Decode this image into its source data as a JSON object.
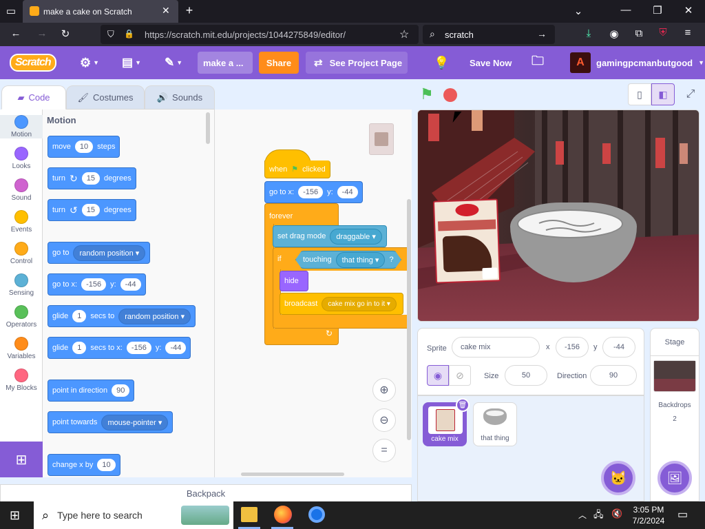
{
  "browser": {
    "tab_title": "make a cake on Scratch",
    "url": "https://scratch.mit.edu/projects/1044275849/editor/",
    "search": "scratch"
  },
  "menubar": {
    "logo": "Scratch",
    "project_title": "make a ...",
    "share": "Share",
    "see_project_page": "See Project Page",
    "save_now": "Save Now",
    "username": "gamingpcmanbutgood"
  },
  "tabs": {
    "code": "Code",
    "costumes": "Costumes",
    "sounds": "Sounds"
  },
  "categories": [
    {
      "label": "Motion",
      "color": "#4c97ff"
    },
    {
      "label": "Looks",
      "color": "#9966ff"
    },
    {
      "label": "Sound",
      "color": "#cf63cf"
    },
    {
      "label": "Events",
      "color": "#ffbf00"
    },
    {
      "label": "Control",
      "color": "#ffab19"
    },
    {
      "label": "Sensing",
      "color": "#5cb1d6"
    },
    {
      "label": "Operators",
      "color": "#59c059"
    },
    {
      "label": "Variables",
      "color": "#ff8c1a"
    },
    {
      "label": "My Blocks",
      "color": "#ff6680"
    }
  ],
  "palette": {
    "heading": "Motion",
    "move": {
      "a": "move",
      "v": "10",
      "b": "steps"
    },
    "turn_right": {
      "a": "turn",
      "v": "15",
      "b": "degrees"
    },
    "turn_left": {
      "a": "turn",
      "v": "15",
      "b": "degrees"
    },
    "goto": {
      "a": "go to",
      "d": "random position"
    },
    "gotoxy": {
      "a": "go to x:",
      "x": "-156",
      "y_label": "y:",
      "y": "-44"
    },
    "glide": {
      "a": "glide",
      "v": "1",
      "b": "secs to",
      "d": "random position"
    },
    "glidexy": {
      "a": "glide",
      "v": "1",
      "b": "secs to x:",
      "x": "-156",
      "y_label": "y:",
      "y": "-44"
    },
    "point_dir": {
      "a": "point in direction",
      "v": "90"
    },
    "point_towards": {
      "a": "point towards",
      "d": "mouse-pointer"
    },
    "change_x": {
      "a": "change x by",
      "v": "10"
    }
  },
  "script": {
    "when_flag": {
      "a": "when",
      "b": "clicked"
    },
    "goto": {
      "a": "go to x:",
      "x": "-156",
      "y_label": "y:",
      "y": "-44"
    },
    "forever": "forever",
    "drag_mode": {
      "a": "set drag mode",
      "d": "draggable"
    },
    "if_label": "if",
    "touching": {
      "a": "touching",
      "d": "that thing",
      "q": "?"
    },
    "hide": "hide",
    "broadcast": {
      "a": "broadcast",
      "d": "cake mix go in to it"
    }
  },
  "sprite_info": {
    "sprite_label": "Sprite",
    "sprite_name": "cake mix",
    "x_label": "x",
    "x": "-156",
    "y_label": "y",
    "y": "-44",
    "show_label": "Show",
    "size_label": "Size",
    "size": "50",
    "direction_label": "Direction",
    "direction": "90"
  },
  "sprites": [
    {
      "name": "cake mix"
    },
    {
      "name": "that thing"
    }
  ],
  "stage_panel": {
    "title": "Stage",
    "backdrops_label": "Backdrops",
    "backdrops_count": "2"
  },
  "backpack": "Backpack",
  "taskbar": {
    "search_placeholder": "Type here to search",
    "time": "3:05 PM",
    "date": "7/2/2024"
  }
}
